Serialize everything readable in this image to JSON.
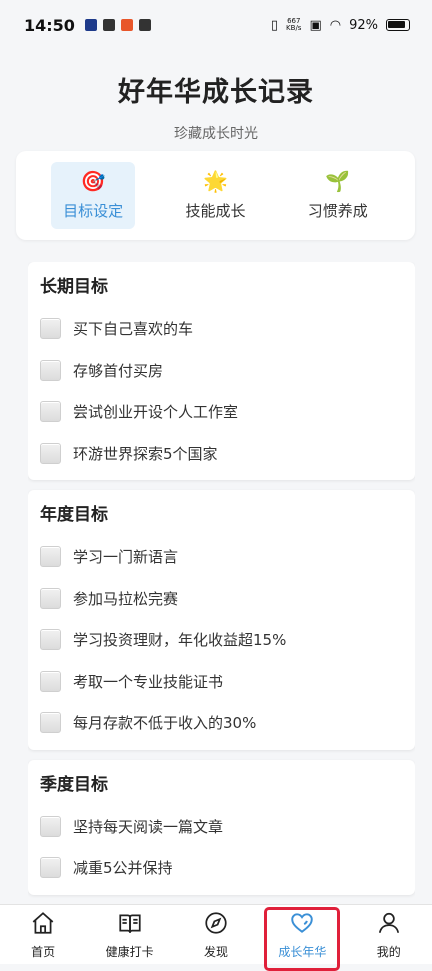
{
  "status_bar": {
    "time": "14:50",
    "net_speed_value": "667",
    "net_speed_unit": "KB/s",
    "battery": "92%"
  },
  "header": {
    "title": "好年华成长记录",
    "subtitle": "珍藏成长时光"
  },
  "tabs": [
    {
      "label": "目标设定",
      "icon": "target-icon",
      "glyph": "🎯",
      "active": true
    },
    {
      "label": "技能成长",
      "icon": "star-icon",
      "glyph": "🌟",
      "active": false
    },
    {
      "label": "习惯养成",
      "icon": "sprout-icon",
      "glyph": "🌱",
      "active": false
    }
  ],
  "goal_sections": [
    {
      "title": "长期目标",
      "items": [
        "买下自己喜欢的车",
        "存够首付买房",
        "尝试创业开设个人工作室",
        "环游世界探索5个国家"
      ]
    },
    {
      "title": "年度目标",
      "items": [
        "学习一门新语言",
        "参加马拉松完赛",
        "学习投资理财，年化收益超15%",
        "考取一个专业技能证书",
        "每月存款不低于收入的30%"
      ]
    },
    {
      "title": "季度目标",
      "items": [
        "坚持每天阅读一篇文章",
        "减重5公并保持"
      ]
    }
  ],
  "bottom_nav": [
    {
      "label": "首页",
      "icon": "home-icon"
    },
    {
      "label": "健康打卡",
      "icon": "book-icon"
    },
    {
      "label": "发现",
      "icon": "compass-icon"
    },
    {
      "label": "成长年华",
      "icon": "heart-icon",
      "active": true
    },
    {
      "label": "我的",
      "icon": "user-icon"
    }
  ],
  "colors": {
    "accent": "#3a8fd6",
    "highlight_border": "#e0203a"
  }
}
